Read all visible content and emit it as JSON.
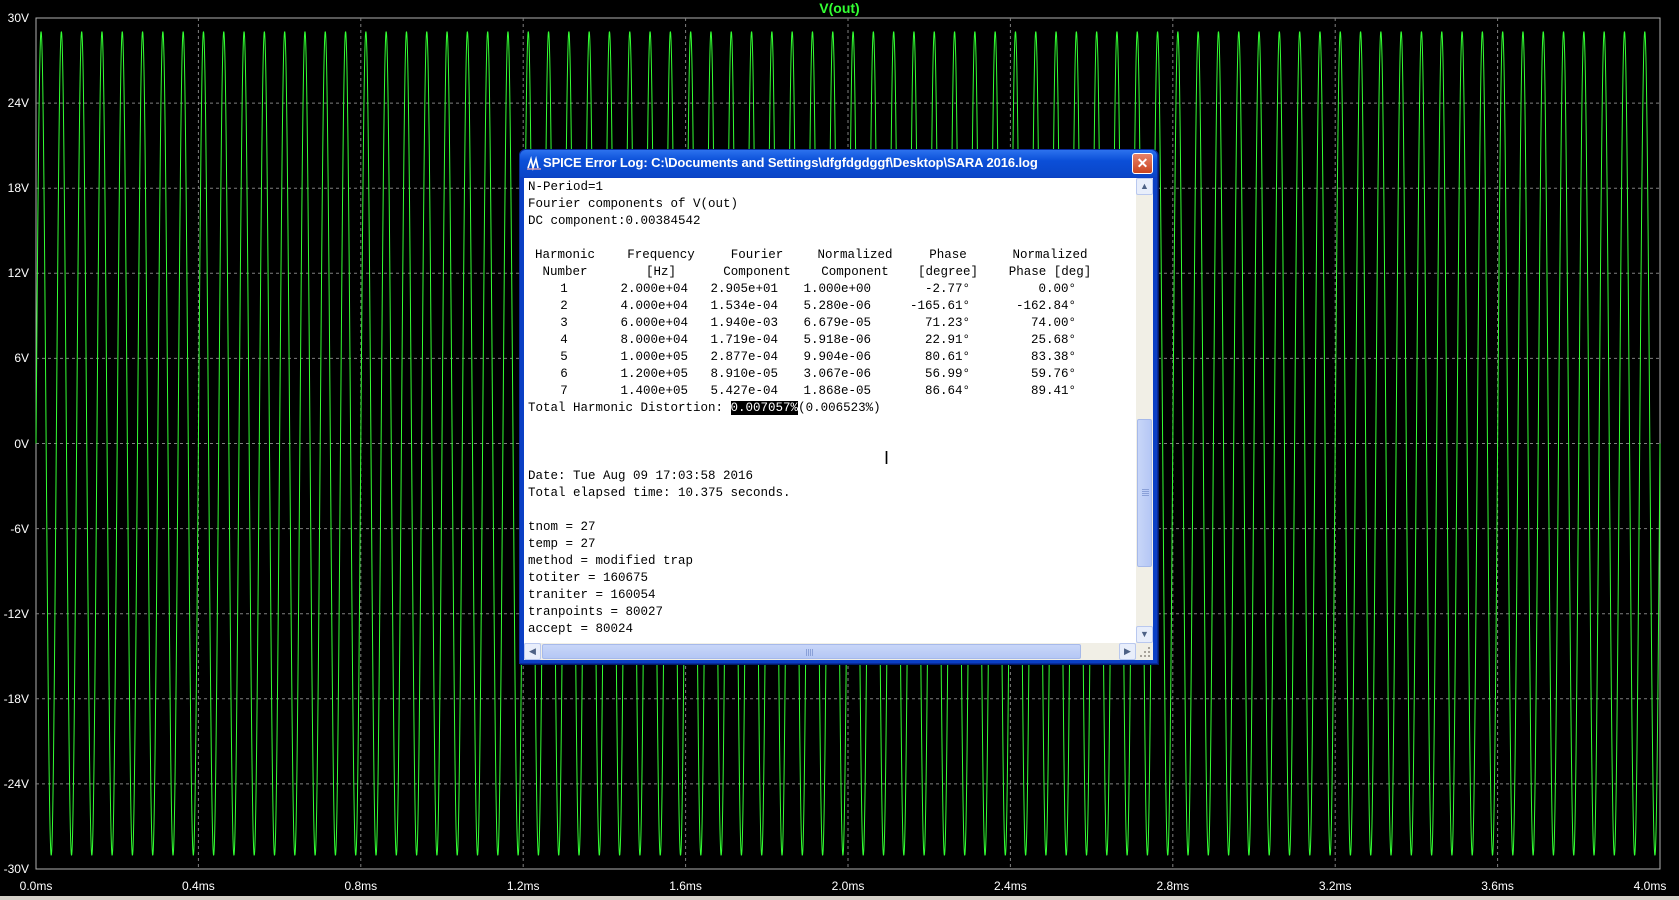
{
  "plot": {
    "trace_name": "V(out)",
    "trace_color": "#33ff33",
    "background": "#000000",
    "grid_color": "#7f7f7f",
    "y_ticks": [
      "30V",
      "24V",
      "18V",
      "12V",
      "6V",
      "0V",
      "-6V",
      "-12V",
      "-18V",
      "-24V",
      "-30V"
    ],
    "x_ticks": [
      "0.0ms",
      "0.4ms",
      "0.8ms",
      "1.2ms",
      "1.6ms",
      "2.0ms",
      "2.4ms",
      "2.8ms",
      "3.2ms",
      "3.6ms",
      "4.0ms"
    ]
  },
  "chart_data": {
    "type": "line",
    "series": [
      {
        "name": "V(out)",
        "amplitude": 29.05,
        "frequency_hz": 20000,
        "dc_offset": 0.00384542
      }
    ],
    "xlim": [
      0,
      4.0
    ],
    "x_unit": "ms",
    "ylim": [
      -30,
      30
    ],
    "y_unit": "V",
    "grid": true
  },
  "dialog": {
    "title": "SPICE Error Log: C:\\Documents and Settings\\dfgfdgdggf\\Desktop\\SARA 2016.log",
    "close_label": "✕",
    "lines_top": [
      "N-Period=1",
      "Fourier components of V(out)",
      "DC component:0.00384542"
    ],
    "table": {
      "header1": [
        "Harmonic",
        "Frequency",
        "Fourier",
        "Normalized",
        "Phase",
        "Normalized"
      ],
      "header2": [
        "Number",
        "[Hz]",
        "Component",
        "Component",
        "[degree]",
        "Phase [deg]"
      ],
      "rows": [
        [
          "1",
          "2.000e+04",
          "2.905e+01",
          "1.000e+00",
          "-2.77°",
          "0.00°"
        ],
        [
          "2",
          "4.000e+04",
          "1.534e-04",
          "5.280e-06",
          "-165.61°",
          "-162.84°"
        ],
        [
          "3",
          "6.000e+04",
          "1.940e-03",
          "6.679e-05",
          "71.23°",
          "74.00°"
        ],
        [
          "4",
          "8.000e+04",
          "1.719e-04",
          "5.918e-06",
          "22.91°",
          "25.68°"
        ],
        [
          "5",
          "1.000e+05",
          "2.877e-04",
          "9.904e-06",
          "80.61°",
          "83.38°"
        ],
        [
          "6",
          "1.200e+05",
          "8.910e-05",
          "3.067e-06",
          "56.99°",
          "59.76°"
        ],
        [
          "7",
          "1.400e+05",
          "5.427e-04",
          "1.868e-05",
          "86.64°",
          "89.41°"
        ]
      ]
    },
    "thd": {
      "label": "Total Harmonic Distortion: ",
      "selected_value": "0.007057%",
      "rest": "(0.006523%)"
    },
    "lines_bottom": [
      "Date: Tue Aug 09 17:03:58 2016",
      "Total elapsed time: 10.375 seconds.",
      "",
      "tnom = 27",
      "temp = 27",
      "method = modified trap",
      "totiter = 160675",
      "traniter = 160054",
      "tranpoints = 80027",
      "accept = 80024"
    ],
    "scroll_up": "▲",
    "scroll_down": "▼",
    "scroll_left": "◀",
    "scroll_right": "▶"
  }
}
